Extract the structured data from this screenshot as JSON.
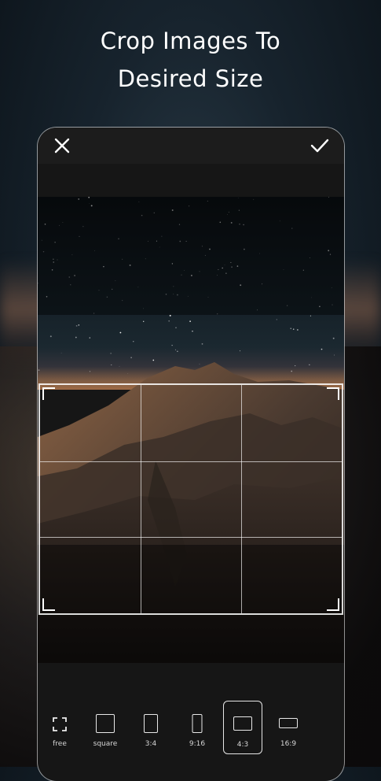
{
  "headline": {
    "line1": "Crop Images To",
    "line2": "Desired Size"
  },
  "toolbar": {
    "close_icon": "close-icon",
    "confirm_icon": "check-icon"
  },
  "editor": {
    "crop_overlay": "grid"
  },
  "ratios": [
    {
      "label": "free",
      "icon": "free-crop-icon"
    },
    {
      "label": "square",
      "icon": "square-ratio-icon"
    },
    {
      "label": "3:4",
      "icon": "ratio-3-4-icon"
    },
    {
      "label": "9:16",
      "icon": "ratio-9-16-icon"
    },
    {
      "label": "4:3",
      "icon": "ratio-4-3-icon",
      "selected": true
    },
    {
      "label": "16:9",
      "icon": "ratio-16-9-icon"
    }
  ],
  "colors": {
    "background": "#17232d",
    "panel": "#161616",
    "topbar": "#1c1c1c",
    "foreground": "#ffffff"
  }
}
